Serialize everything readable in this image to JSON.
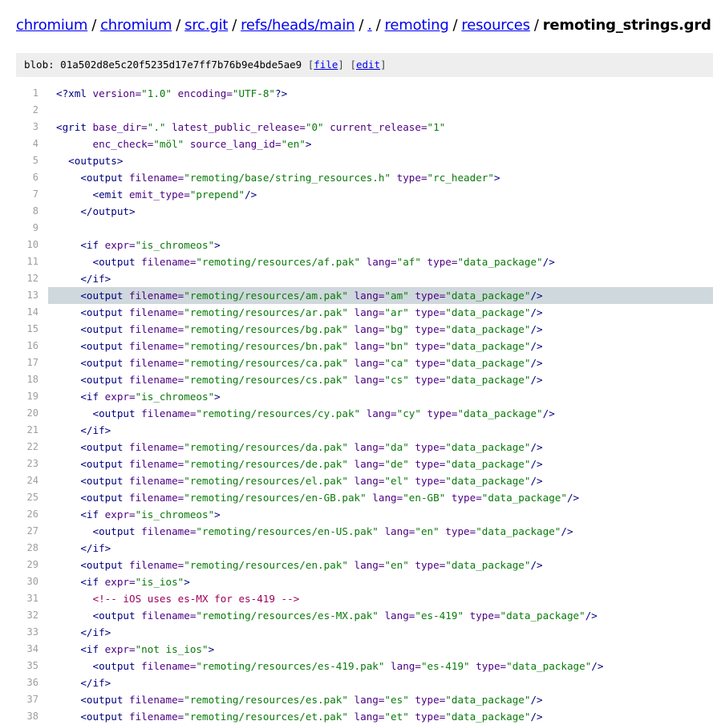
{
  "breadcrumb": {
    "items": [
      {
        "label": "chromium"
      },
      {
        "label": "chromium"
      },
      {
        "label": "src.git"
      },
      {
        "label": "refs/heads/main"
      },
      {
        "label": "."
      },
      {
        "label": "remoting"
      },
      {
        "label": "resources"
      }
    ],
    "separator": "/",
    "current": "remoting_strings.grd"
  },
  "blob": {
    "prefix": "blob:",
    "hash": "01a502d8e5c20f5235d17e7ff7b76b9e4bde5ae9",
    "file_label": "file",
    "edit_label": "edit",
    "open_bracket": "[",
    "close_bracket": "]"
  },
  "highlighted_line": 13,
  "code_lines": [
    [
      [
        "tg",
        "<?xml "
      ],
      [
        "at",
        "version="
      ],
      [
        "vl",
        "\"1.0\""
      ],
      [
        "at",
        " encoding="
      ],
      [
        "vl",
        "\"UTF-8\""
      ],
      [
        "tg",
        "?>"
      ]
    ],
    [],
    [
      [
        "tg",
        "<grit "
      ],
      [
        "at",
        "base_dir="
      ],
      [
        "vl",
        "\".\""
      ],
      [
        "at",
        " latest_public_release="
      ],
      [
        "vl",
        "\"0\""
      ],
      [
        "at",
        " current_release="
      ],
      [
        "vl",
        "\"1\""
      ]
    ],
    [
      [
        "at",
        "      enc_check="
      ],
      [
        "vl",
        "\"möl\""
      ],
      [
        "at",
        " source_lang_id="
      ],
      [
        "vl",
        "\"en\""
      ],
      [
        "tg",
        ">"
      ]
    ],
    [
      [
        "tg",
        "  <outputs>"
      ]
    ],
    [
      [
        "tg",
        "    <output "
      ],
      [
        "at",
        "filename="
      ],
      [
        "vl",
        "\"remoting/base/string_resources.h\""
      ],
      [
        "at",
        " type="
      ],
      [
        "vl",
        "\"rc_header\""
      ],
      [
        "tg",
        ">"
      ]
    ],
    [
      [
        "tg",
        "      <emit "
      ],
      [
        "at",
        "emit_type="
      ],
      [
        "vl",
        "\"prepend\""
      ],
      [
        "tg",
        "/>"
      ]
    ],
    [
      [
        "tg",
        "    </output>"
      ]
    ],
    [],
    [
      [
        "tg",
        "    <if "
      ],
      [
        "at",
        "expr="
      ],
      [
        "vl",
        "\"is_chromeos\""
      ],
      [
        "tg",
        ">"
      ]
    ],
    [
      [
        "tg",
        "      <output "
      ],
      [
        "at",
        "filename="
      ],
      [
        "vl",
        "\"remoting/resources/af.pak\""
      ],
      [
        "at",
        " lang="
      ],
      [
        "vl",
        "\"af\""
      ],
      [
        "at",
        " type="
      ],
      [
        "vl",
        "\"data_package\""
      ],
      [
        "tg",
        "/>"
      ]
    ],
    [
      [
        "tg",
        "    </if>"
      ]
    ],
    [
      [
        "tg",
        "    <output "
      ],
      [
        "at",
        "filename="
      ],
      [
        "vl",
        "\"remoting/resources/am.pak\""
      ],
      [
        "at",
        " lang="
      ],
      [
        "vl",
        "\"am\""
      ],
      [
        "at",
        " type="
      ],
      [
        "vl",
        "\"data_package\""
      ],
      [
        "tg",
        "/>"
      ]
    ],
    [
      [
        "tg",
        "    <output "
      ],
      [
        "at",
        "filename="
      ],
      [
        "vl",
        "\"remoting/resources/ar.pak\""
      ],
      [
        "at",
        " lang="
      ],
      [
        "vl",
        "\"ar\""
      ],
      [
        "at",
        " type="
      ],
      [
        "vl",
        "\"data_package\""
      ],
      [
        "tg",
        "/>"
      ]
    ],
    [
      [
        "tg",
        "    <output "
      ],
      [
        "at",
        "filename="
      ],
      [
        "vl",
        "\"remoting/resources/bg.pak\""
      ],
      [
        "at",
        " lang="
      ],
      [
        "vl",
        "\"bg\""
      ],
      [
        "at",
        " type="
      ],
      [
        "vl",
        "\"data_package\""
      ],
      [
        "tg",
        "/>"
      ]
    ],
    [
      [
        "tg",
        "    <output "
      ],
      [
        "at",
        "filename="
      ],
      [
        "vl",
        "\"remoting/resources/bn.pak\""
      ],
      [
        "at",
        " lang="
      ],
      [
        "vl",
        "\"bn\""
      ],
      [
        "at",
        " type="
      ],
      [
        "vl",
        "\"data_package\""
      ],
      [
        "tg",
        "/>"
      ]
    ],
    [
      [
        "tg",
        "    <output "
      ],
      [
        "at",
        "filename="
      ],
      [
        "vl",
        "\"remoting/resources/ca.pak\""
      ],
      [
        "at",
        " lang="
      ],
      [
        "vl",
        "\"ca\""
      ],
      [
        "at",
        " type="
      ],
      [
        "vl",
        "\"data_package\""
      ],
      [
        "tg",
        "/>"
      ]
    ],
    [
      [
        "tg",
        "    <output "
      ],
      [
        "at",
        "filename="
      ],
      [
        "vl",
        "\"remoting/resources/cs.pak\""
      ],
      [
        "at",
        " lang="
      ],
      [
        "vl",
        "\"cs\""
      ],
      [
        "at",
        " type="
      ],
      [
        "vl",
        "\"data_package\""
      ],
      [
        "tg",
        "/>"
      ]
    ],
    [
      [
        "tg",
        "    <if "
      ],
      [
        "at",
        "expr="
      ],
      [
        "vl",
        "\"is_chromeos\""
      ],
      [
        "tg",
        ">"
      ]
    ],
    [
      [
        "tg",
        "      <output "
      ],
      [
        "at",
        "filename="
      ],
      [
        "vl",
        "\"remoting/resources/cy.pak\""
      ],
      [
        "at",
        " lang="
      ],
      [
        "vl",
        "\"cy\""
      ],
      [
        "at",
        " type="
      ],
      [
        "vl",
        "\"data_package\""
      ],
      [
        "tg",
        "/>"
      ]
    ],
    [
      [
        "tg",
        "    </if>"
      ]
    ],
    [
      [
        "tg",
        "    <output "
      ],
      [
        "at",
        "filename="
      ],
      [
        "vl",
        "\"remoting/resources/da.pak\""
      ],
      [
        "at",
        " lang="
      ],
      [
        "vl",
        "\"da\""
      ],
      [
        "at",
        " type="
      ],
      [
        "vl",
        "\"data_package\""
      ],
      [
        "tg",
        "/>"
      ]
    ],
    [
      [
        "tg",
        "    <output "
      ],
      [
        "at",
        "filename="
      ],
      [
        "vl",
        "\"remoting/resources/de.pak\""
      ],
      [
        "at",
        " lang="
      ],
      [
        "vl",
        "\"de\""
      ],
      [
        "at",
        " type="
      ],
      [
        "vl",
        "\"data_package\""
      ],
      [
        "tg",
        "/>"
      ]
    ],
    [
      [
        "tg",
        "    <output "
      ],
      [
        "at",
        "filename="
      ],
      [
        "vl",
        "\"remoting/resources/el.pak\""
      ],
      [
        "at",
        " lang="
      ],
      [
        "vl",
        "\"el\""
      ],
      [
        "at",
        " type="
      ],
      [
        "vl",
        "\"data_package\""
      ],
      [
        "tg",
        "/>"
      ]
    ],
    [
      [
        "tg",
        "    <output "
      ],
      [
        "at",
        "filename="
      ],
      [
        "vl",
        "\"remoting/resources/en-GB.pak\""
      ],
      [
        "at",
        " lang="
      ],
      [
        "vl",
        "\"en-GB\""
      ],
      [
        "at",
        " type="
      ],
      [
        "vl",
        "\"data_package\""
      ],
      [
        "tg",
        "/>"
      ]
    ],
    [
      [
        "tg",
        "    <if "
      ],
      [
        "at",
        "expr="
      ],
      [
        "vl",
        "\"is_chromeos\""
      ],
      [
        "tg",
        ">"
      ]
    ],
    [
      [
        "tg",
        "      <output "
      ],
      [
        "at",
        "filename="
      ],
      [
        "vl",
        "\"remoting/resources/en-US.pak\""
      ],
      [
        "at",
        " lang="
      ],
      [
        "vl",
        "\"en\""
      ],
      [
        "at",
        " type="
      ],
      [
        "vl",
        "\"data_package\""
      ],
      [
        "tg",
        "/>"
      ]
    ],
    [
      [
        "tg",
        "    </if>"
      ]
    ],
    [
      [
        "tg",
        "    <output "
      ],
      [
        "at",
        "filename="
      ],
      [
        "vl",
        "\"remoting/resources/en.pak\""
      ],
      [
        "at",
        " lang="
      ],
      [
        "vl",
        "\"en\""
      ],
      [
        "at",
        " type="
      ],
      [
        "vl",
        "\"data_package\""
      ],
      [
        "tg",
        "/>"
      ]
    ],
    [
      [
        "tg",
        "    <if "
      ],
      [
        "at",
        "expr="
      ],
      [
        "vl",
        "\"is_ios\""
      ],
      [
        "tg",
        ">"
      ]
    ],
    [
      [
        "cm",
        "      <!-- iOS uses es-MX for es-419 -->"
      ]
    ],
    [
      [
        "tg",
        "      <output "
      ],
      [
        "at",
        "filename="
      ],
      [
        "vl",
        "\"remoting/resources/es-MX.pak\""
      ],
      [
        "at",
        " lang="
      ],
      [
        "vl",
        "\"es-419\""
      ],
      [
        "at",
        " type="
      ],
      [
        "vl",
        "\"data_package\""
      ],
      [
        "tg",
        "/>"
      ]
    ],
    [
      [
        "tg",
        "    </if>"
      ]
    ],
    [
      [
        "tg",
        "    <if "
      ],
      [
        "at",
        "expr="
      ],
      [
        "vl",
        "\"not is_ios\""
      ],
      [
        "tg",
        ">"
      ]
    ],
    [
      [
        "tg",
        "      <output "
      ],
      [
        "at",
        "filename="
      ],
      [
        "vl",
        "\"remoting/resources/es-419.pak\""
      ],
      [
        "at",
        " lang="
      ],
      [
        "vl",
        "\"es-419\""
      ],
      [
        "at",
        " type="
      ],
      [
        "vl",
        "\"data_package\""
      ],
      [
        "tg",
        "/>"
      ]
    ],
    [
      [
        "tg",
        "    </if>"
      ]
    ],
    [
      [
        "tg",
        "    <output "
      ],
      [
        "at",
        "filename="
      ],
      [
        "vl",
        "\"remoting/resources/es.pak\""
      ],
      [
        "at",
        " lang="
      ],
      [
        "vl",
        "\"es\""
      ],
      [
        "at",
        " type="
      ],
      [
        "vl",
        "\"data_package\""
      ],
      [
        "tg",
        "/>"
      ]
    ],
    [
      [
        "tg",
        "    <output "
      ],
      [
        "at",
        "filename="
      ],
      [
        "vl",
        "\"remoting/resources/et.pak\""
      ],
      [
        "at",
        " lang="
      ],
      [
        "vl",
        "\"et\""
      ],
      [
        "at",
        " type="
      ],
      [
        "vl",
        "\"data_package\""
      ],
      [
        "tg",
        "/>"
      ]
    ]
  ],
  "colors": {
    "link": "#0000ee",
    "tag": "#000080",
    "attribute": "#4b0082",
    "value": "#0a7a0a",
    "comment": "#a0005a",
    "line_number": "#9e9e9e",
    "highlight": "#cfd8dc",
    "blob_bar": "#eeeeee"
  }
}
